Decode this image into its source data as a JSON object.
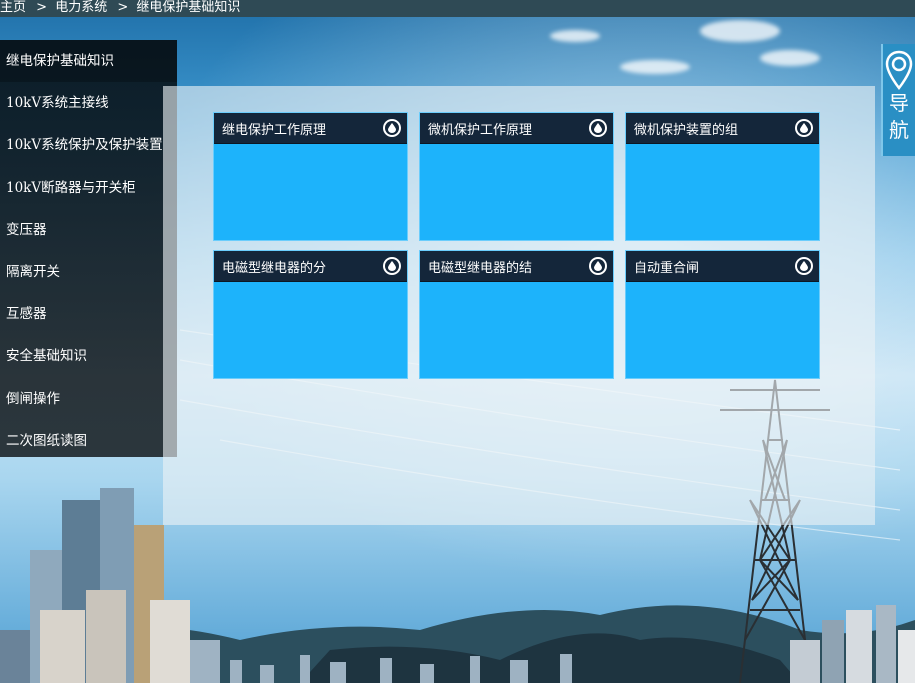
{
  "breadcrumb": {
    "home": "主页",
    "sep1": ">",
    "level1": "电力系统",
    "sep2": ">",
    "current": "继电保护基础知识"
  },
  "sidebar": {
    "items": [
      {
        "label": "继电保护基础知识"
      },
      {
        "label": "10kV系统主接线"
      },
      {
        "label": "10kV系统保护及保护装置"
      },
      {
        "label": "10kV断路器与开关柜"
      },
      {
        "label": "变压器"
      },
      {
        "label": "隔离开关"
      },
      {
        "label": "互感器"
      },
      {
        "label": "安全基础知识"
      },
      {
        "label": "倒闸操作"
      },
      {
        "label": "二次图纸读图"
      }
    ]
  },
  "cards": [
    {
      "title": "继电保护工作原理"
    },
    {
      "title": "微机保护工作原理"
    },
    {
      "title": "微机保护装置的组"
    },
    {
      "title": "电磁型继电器的分"
    },
    {
      "title": "电磁型继电器的结"
    },
    {
      "title": "自动重合闸"
    }
  ],
  "nav_tab": {
    "label": "导航",
    "icon": "map-pin-icon"
  },
  "colors": {
    "card_body": "#1db3fb",
    "card_header": "#14263a",
    "breadcrumb_bar": "#2f4a55",
    "nav_tab": "#2a8fc4"
  }
}
